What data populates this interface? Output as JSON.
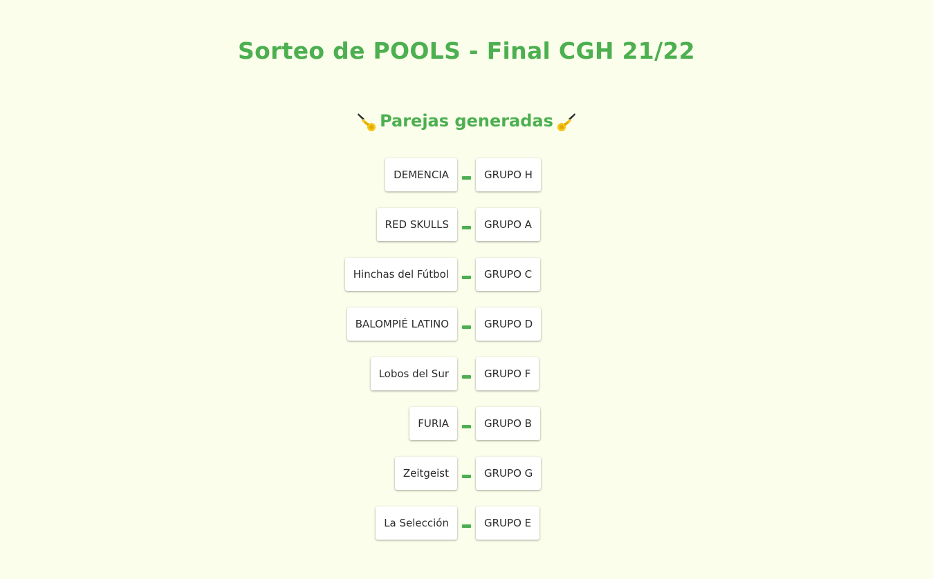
{
  "header": {
    "title": "Sorteo de POOLS - Final CGH 21/22",
    "subtitle": "Parejas generadas",
    "subtitle_icon_left": "trumpet-icon",
    "subtitle_icon_right": "trumpet-icon"
  },
  "colors": {
    "accent": "#4caf50",
    "background": "#fbfeeb",
    "card": "#ffffff",
    "text": "#2b2b2b",
    "trumpet": "#f5c518"
  },
  "pairs": [
    {
      "team": "DEMENCIA",
      "group": "GRUPO H"
    },
    {
      "team": "RED SKULLS",
      "group": "GRUPO A"
    },
    {
      "team": "Hinchas del Fútbol",
      "group": "GRUPO C"
    },
    {
      "team": "BALOMPIÉ LATINO",
      "group": "GRUPO D"
    },
    {
      "team": "Lobos del Sur",
      "group": "GRUPO F"
    },
    {
      "team": "FURIA",
      "group": "GRUPO B"
    },
    {
      "team": "Zeitgeist",
      "group": "GRUPO G"
    },
    {
      "team": "La Selección",
      "group": "GRUPO E"
    }
  ]
}
